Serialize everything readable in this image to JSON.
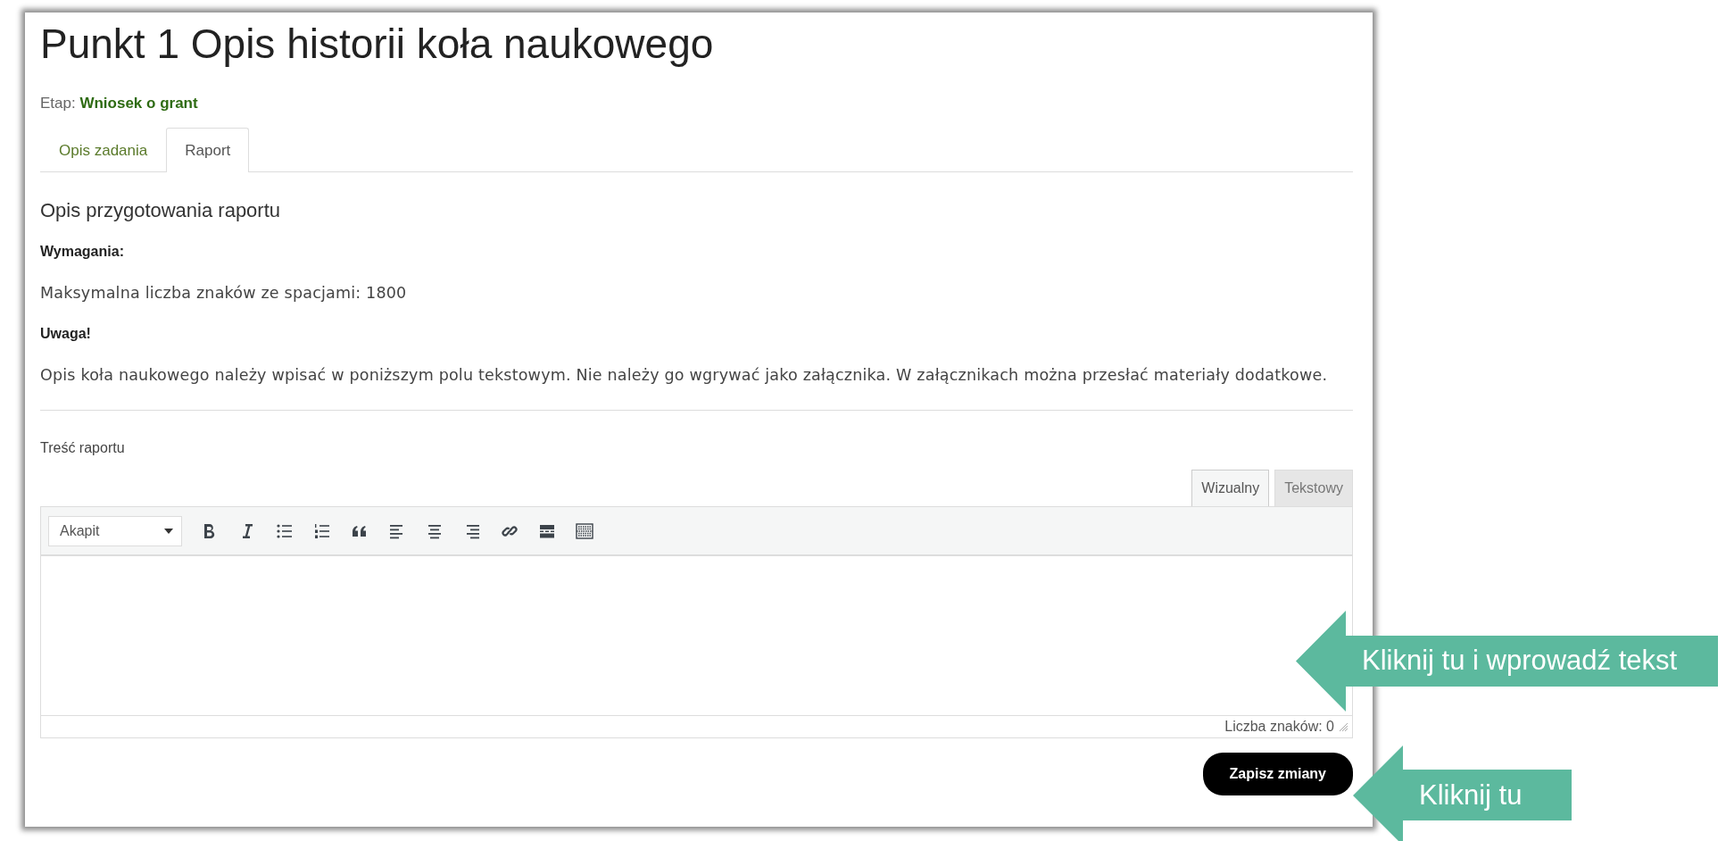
{
  "page": {
    "title": "Punkt 1 Opis historii koła naukowego",
    "stage_label": "Etap:",
    "stage_value": "Wniosek o grant"
  },
  "tabs": [
    {
      "label": "Opis zadania",
      "selected": false
    },
    {
      "label": "Raport",
      "selected": true
    }
  ],
  "report_description": {
    "heading": "Opis przygotowania raportu",
    "blocks": [
      {
        "kind": "heading",
        "text": "Wymagania:"
      },
      {
        "kind": "paragraph",
        "text": "Maksymalna liczba znaków ze spacjami: 1800"
      },
      {
        "kind": "heading",
        "text": "Uwaga!"
      },
      {
        "kind": "paragraph",
        "text": "Opis koła naukowego należy wpisać w poniższym polu tekstowym. Nie należy go wgrywać jako załącznika. W załącznikach można przesłać materiały dodatkowe."
      }
    ]
  },
  "editor": {
    "label": "Treść raportu",
    "tabs": [
      {
        "label": "Wizualny",
        "selected": true
      },
      {
        "label": "Tekstowy",
        "selected": false
      }
    ],
    "format_select": "Akapit",
    "toolbar": [
      {
        "kind": "bold"
      },
      {
        "kind": "italic"
      },
      {
        "kind": "bullet-list"
      },
      {
        "kind": "numbered-list"
      },
      {
        "kind": "quote"
      },
      {
        "kind": "align-left"
      },
      {
        "kind": "align-center"
      },
      {
        "kind": "align-right"
      },
      {
        "kind": "link"
      },
      {
        "kind": "read-more"
      },
      {
        "kind": "toolbar-toggle"
      }
    ],
    "char_count": "Liczba znaków: 0"
  },
  "save_button": "Zapisz zmiany",
  "callouts": [
    {
      "text": "Kliknij tu i wprowadź tekst"
    },
    {
      "text": "Kliknij tu"
    }
  ]
}
